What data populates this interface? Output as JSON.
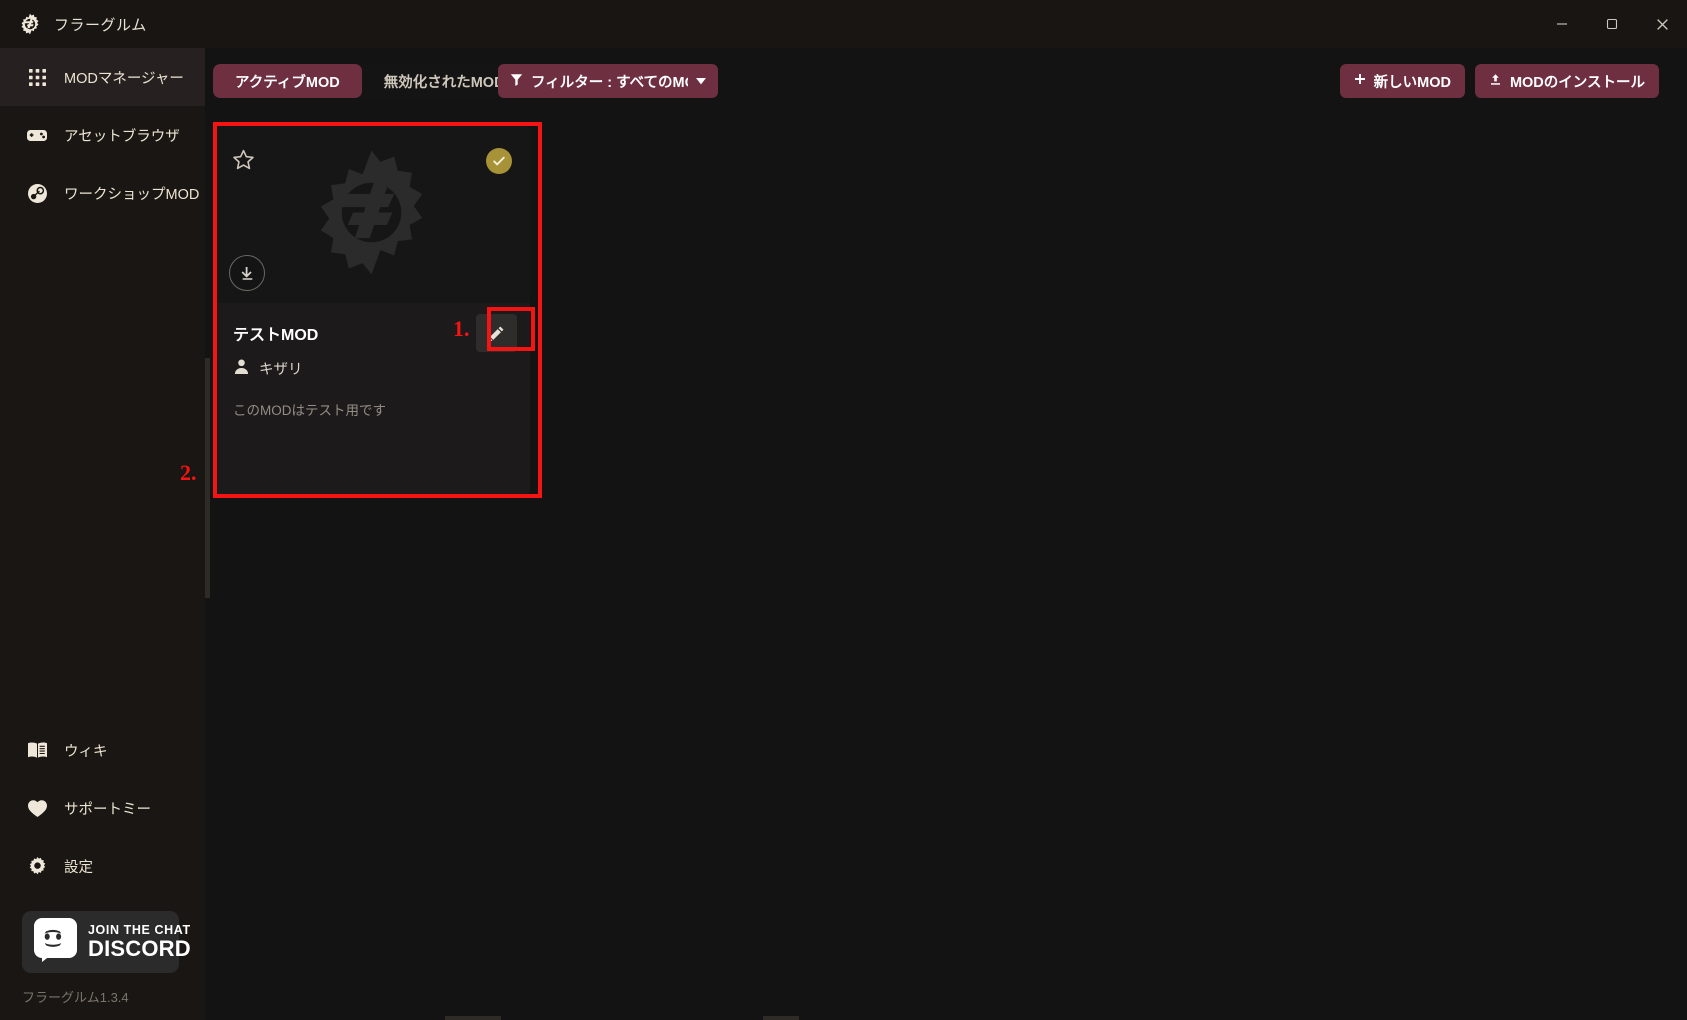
{
  "window": {
    "title": "フラーグルム",
    "logo_icon": "gear-logo-icon",
    "minimize_icon": "minimize-icon",
    "maximize_icon": "maximize-icon",
    "close_icon": "close-icon"
  },
  "sidebar": {
    "top_items": [
      {
        "label": "MODマネージャー",
        "icon": "grid-apps-icon",
        "active": true
      },
      {
        "label": "アセットブラウザ",
        "icon": "gamepad-icon",
        "active": false
      },
      {
        "label": "ワークショップMOD",
        "icon": "steam-icon",
        "active": false
      }
    ],
    "bottom_items": [
      {
        "label": "ウィキ",
        "icon": "book-icon"
      },
      {
        "label": "サポートミー",
        "icon": "heart-icon"
      },
      {
        "label": "設定",
        "icon": "gear-icon"
      }
    ],
    "discord": {
      "line1": "JOIN THE CHAT",
      "line2": "DISCORD",
      "icon": "discord-icon"
    },
    "version": "フラーグルム1.3.4"
  },
  "toolbar": {
    "tabs": [
      {
        "label": "アクティブMOD",
        "active": true
      },
      {
        "label": "無効化されたMOD",
        "active": false
      }
    ],
    "filter": {
      "icon": "filter-icon",
      "label": "フィルター : すべてのMOD",
      "caret_icon": "chevron-down-icon"
    },
    "actions": [
      {
        "label": "新しいMOD",
        "icon": "plus-icon"
      },
      {
        "label": "MODのインストール",
        "icon": "upload-icon"
      }
    ]
  },
  "mods": [
    {
      "title": "テストMOD",
      "author": "キザリ",
      "author_icon": "person-icon",
      "description": "このMODはテスト用です",
      "favorite_icon": "star-outline-icon",
      "enabled_icon": "check-circle-icon",
      "download_icon": "download-icon",
      "edit_icon": "pencil-icon",
      "watermark_icon": "gear-logo-watermark"
    }
  ],
  "annotations": [
    {
      "id": "1",
      "label": "1.",
      "target": "edit-button"
    },
    {
      "id": "2",
      "label": "2.",
      "target": "mod-card"
    }
  ],
  "colors": {
    "accent": "#6e2f40",
    "badge": "#a89237",
    "annotation": "#f51414",
    "sidebar_bg": "#1a1613",
    "titlebar_bg": "#191513",
    "content_bg": "#131313",
    "card_bg": "#1c1a1a",
    "text": "#ece4d2"
  }
}
